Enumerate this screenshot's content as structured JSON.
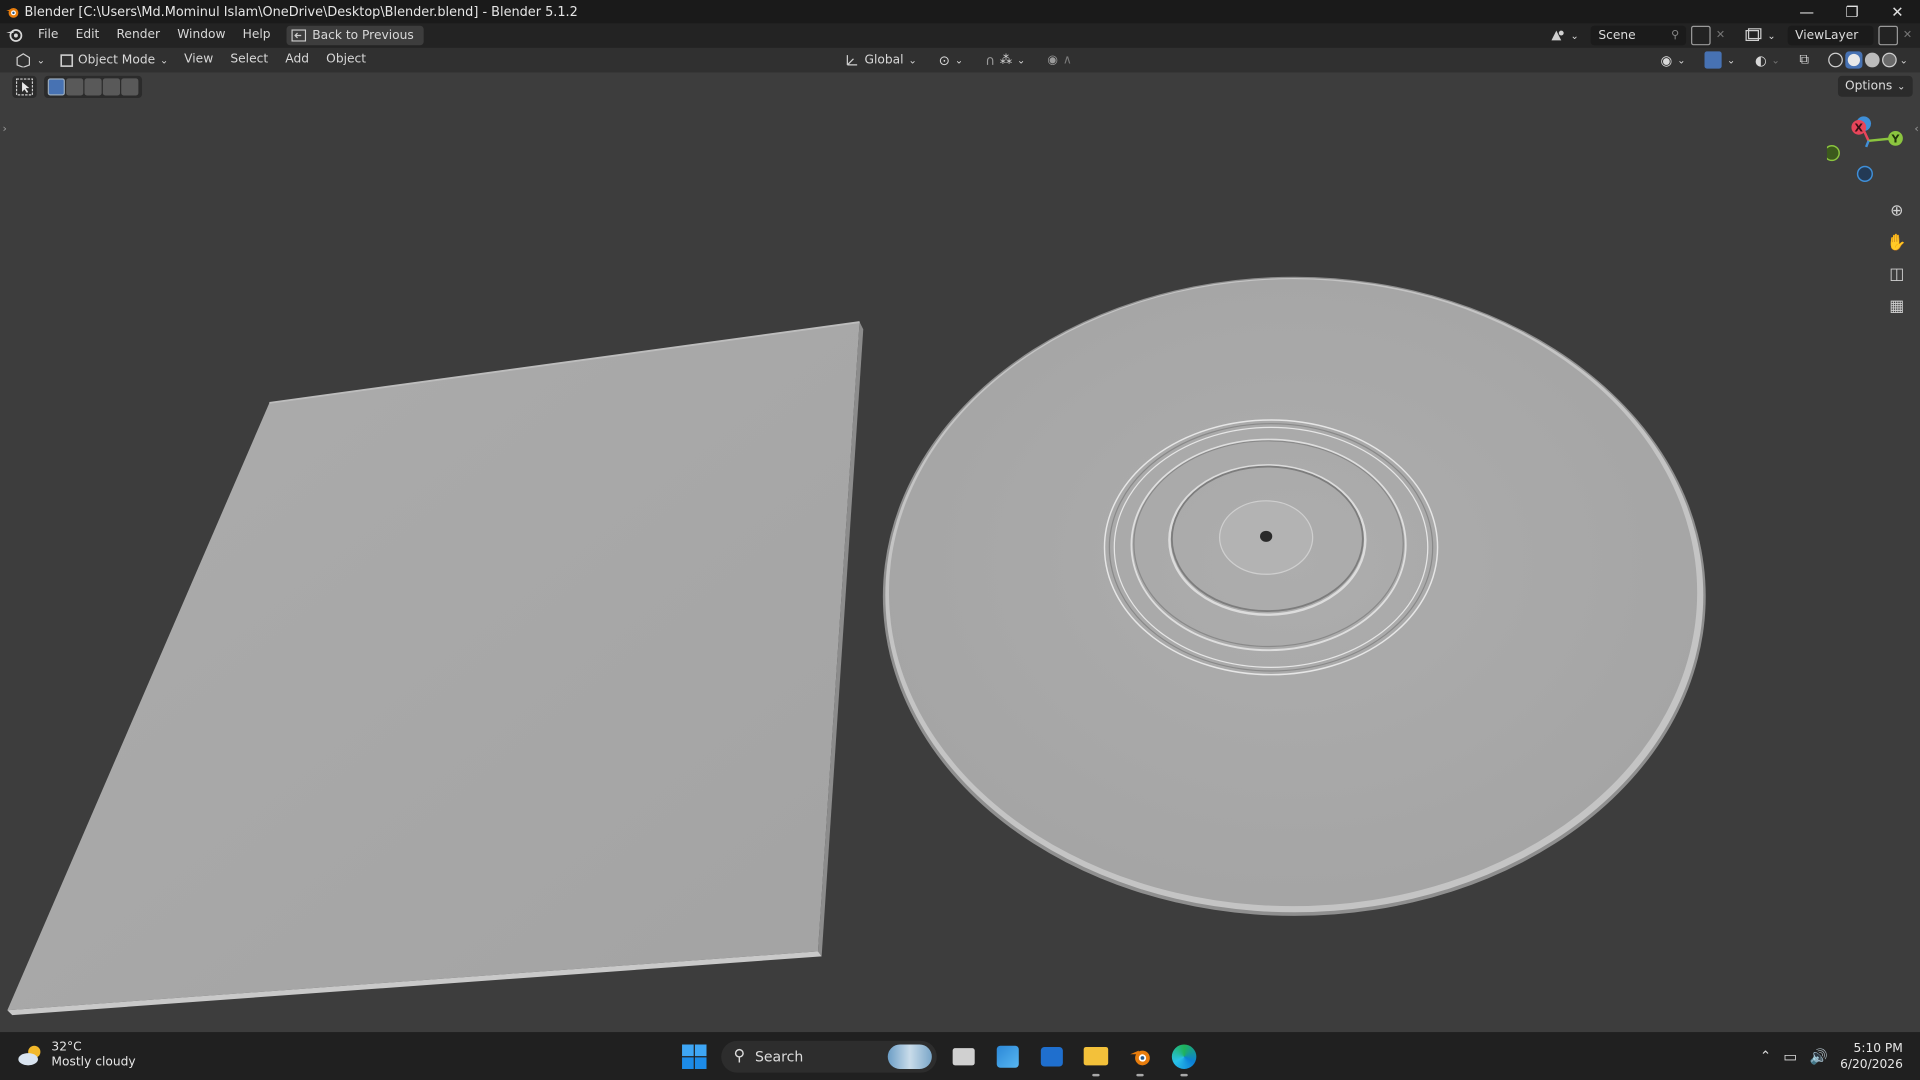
{
  "window": {
    "title": "Blender [C:\\Users\\Md.Mominul Islam\\OneDrive\\Desktop\\Blender.blend] - Blender 5.1.2",
    "controls": [
      "—",
      "❐",
      "✕"
    ]
  },
  "topbar": {
    "menus": [
      "File",
      "Edit",
      "Render",
      "Window",
      "Help"
    ],
    "back_label": "Back to Previous",
    "scene": "Scene",
    "view_layer": "ViewLayer"
  },
  "viewport_header": {
    "mode": "Object Mode",
    "menus": [
      "View",
      "Select",
      "Add",
      "Object"
    ],
    "orientation": "Global"
  },
  "viewport": {
    "options_label": "Options",
    "gizmo": {
      "x": "X",
      "y": "Y"
    },
    "objects": [
      "album-cover-plane",
      "vinyl-record-disc"
    ]
  },
  "taskbar": {
    "weather": {
      "temp": "32°C",
      "condition": "Mostly cloudy"
    },
    "search_label": "Search",
    "time": "5:10 PM",
    "date": "6/20/2026"
  },
  "colors": {
    "viewport_bg": "#3d3d3d",
    "object_gray": "#a9a9a9",
    "axis_x": "#e8455a",
    "axis_y": "#8bc53f",
    "axis_z": "#3f8fd8",
    "accent": "#4772b3"
  }
}
